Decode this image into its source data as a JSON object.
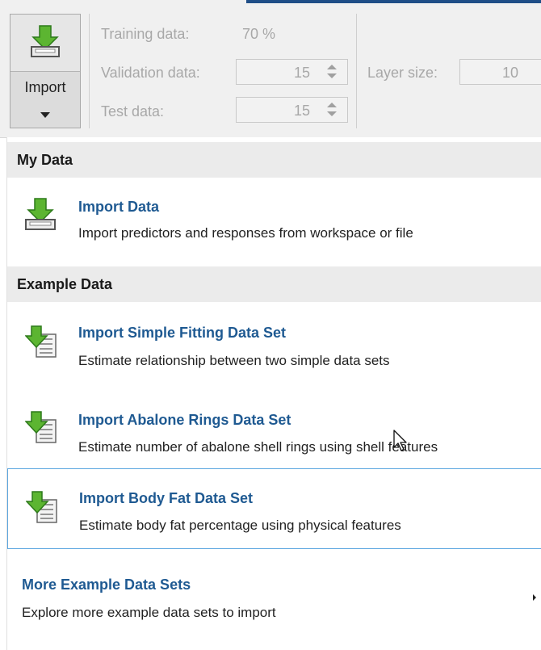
{
  "toolstrip": {
    "import_button": {
      "label": "Import"
    },
    "training": {
      "label": "Training data:",
      "value": "70 %"
    },
    "validation": {
      "label": "Validation data:",
      "value": "15"
    },
    "test": {
      "label": "Test data:",
      "value": "15"
    },
    "layer_size": {
      "label": "Layer size:",
      "value": "10"
    }
  },
  "menu": {
    "my_data": {
      "header": "My Data",
      "items": [
        {
          "title": "Import Data",
          "description": "Import predictors and responses from workspace or file",
          "icon": "import-data-icon"
        }
      ]
    },
    "example_data": {
      "header": "Example Data",
      "items": [
        {
          "title": "Import Simple Fitting Data Set",
          "description": "Estimate relationship between two simple data sets",
          "icon": "import-dataset-icon"
        },
        {
          "title": "Import Abalone Rings Data Set",
          "description": "Estimate number of abalone shell rings using shell features",
          "icon": "import-dataset-icon"
        },
        {
          "title": "Import Body Fat Data Set",
          "description": "Estimate body fat percentage using physical features",
          "icon": "import-dataset-icon",
          "selected": true
        }
      ]
    },
    "more": {
      "title": "More Example Data Sets",
      "description": "Explore more example data sets to import",
      "icon": "submenu-arrow-icon"
    }
  },
  "colors": {
    "accent_link": "#1f5a92",
    "arrow_green": "#5cb531",
    "selection_border": "#5ba6e0",
    "header_bg": "#ebebeb"
  }
}
